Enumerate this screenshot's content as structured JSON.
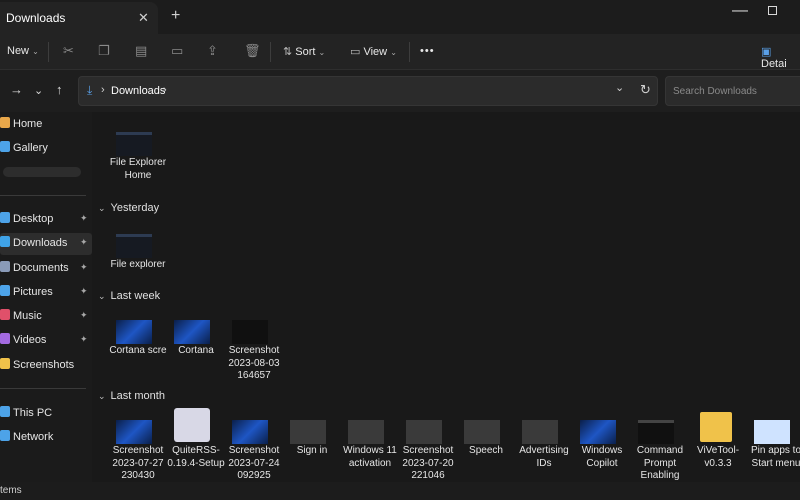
{
  "tab": {
    "title": "Downloads",
    "close": "✕",
    "new_tab": "+"
  },
  "window": {
    "minimize": "—"
  },
  "commandbar": {
    "new_label": "New",
    "sort_label": "Sort",
    "view_label": "View",
    "more": "•••",
    "details_label": "Detai"
  },
  "address": {
    "path": "Downloads",
    "chevron": "›",
    "dropdown": "⌄",
    "refresh": "↻"
  },
  "search": {
    "placeholder": "Search Downloads"
  },
  "sidebar": {
    "items": [
      {
        "label": "Home",
        "icon": "home-icon",
        "color": "#e8a74a"
      },
      {
        "label": "Gallery",
        "icon": "gallery-icon",
        "color": "#4da3e8"
      },
      {
        "label": "Desktop",
        "icon": "desktop-icon",
        "color": "#4da3e8",
        "pinned": true
      },
      {
        "label": "Downloads",
        "icon": "downloads-icon",
        "color": "#3fa3e8",
        "pinned": true
      },
      {
        "label": "Documents",
        "icon": "documents-icon",
        "color": "#8a9bb8",
        "pinned": true
      },
      {
        "label": "Pictures",
        "icon": "pictures-icon",
        "color": "#4da3e8",
        "pinned": true
      },
      {
        "label": "Music",
        "icon": "music-icon",
        "color": "#e0506a",
        "pinned": true
      },
      {
        "label": "Videos",
        "icon": "videos-icon",
        "color": "#a36ae0",
        "pinned": true
      },
      {
        "label": "Screenshots",
        "icon": "folder-icon",
        "color": "#f0c24a"
      },
      {
        "label": "This PC",
        "icon": "this-pc-icon",
        "color": "#4da3e8"
      },
      {
        "label": "Network",
        "icon": "network-icon",
        "color": "#4da3e8"
      }
    ],
    "pin_glyph": "📌"
  },
  "groups": [
    {
      "label": "Yesterday"
    },
    {
      "label": "Last week"
    },
    {
      "label": "Last month"
    }
  ],
  "files": {
    "today": [
      {
        "name": "File Explorer Home",
        "thumb": "fe"
      }
    ],
    "yesterday": [
      {
        "name": "File explorer",
        "thumb": "fe"
      }
    ],
    "last_week": [
      {
        "name": "Cortana scre",
        "thumb": "win"
      },
      {
        "name": "Cortana",
        "thumb": "win"
      },
      {
        "name": "Screenshot 2023-08-03 164657",
        "thumb": "dark"
      }
    ],
    "last_month": [
      {
        "name": "Screenshot 2023-07-27 230430",
        "thumb": "win"
      },
      {
        "name": "QuiteRSS-0.19.4-Setup",
        "thumb": "setup"
      },
      {
        "name": "Screenshot 2023-07-24 092925",
        "thumb": "win"
      },
      {
        "name": "Sign in",
        "thumb": "gray"
      },
      {
        "name": "Windows 11 activation",
        "thumb": "gray"
      },
      {
        "name": "Screenshot 2023-07-20 221046",
        "thumb": "gray"
      },
      {
        "name": "Speech",
        "thumb": "gray"
      },
      {
        "name": "Advertising IDs",
        "thumb": "gray"
      },
      {
        "name": "Windows Copilot",
        "thumb": "win"
      },
      {
        "name": "Command Prompt Enabling",
        "thumb": "dark"
      },
      {
        "name": "ViVeTool-v0.3.3",
        "thumb": "folder"
      },
      {
        "name": "Pin apps to Start menu",
        "thumb": "win"
      }
    ]
  },
  "statusbar": {
    "text": "tems"
  }
}
